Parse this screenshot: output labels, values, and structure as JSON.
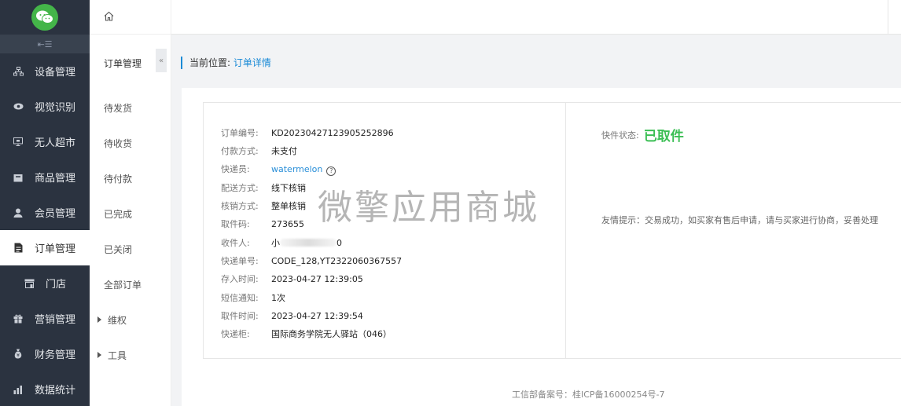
{
  "sidebar": {
    "items": [
      {
        "label": "设备管理",
        "icon": "device-icon"
      },
      {
        "label": "视觉识别",
        "icon": "eye-icon"
      },
      {
        "label": "无人超市",
        "icon": "monitor-icon"
      },
      {
        "label": "商品管理",
        "icon": "box-icon"
      },
      {
        "label": "会员管理",
        "icon": "user-icon"
      },
      {
        "label": "订单管理",
        "icon": "document-icon"
      },
      {
        "label": "门店",
        "icon": "store-icon"
      },
      {
        "label": "营销管理",
        "icon": "gift-icon"
      },
      {
        "label": "财务管理",
        "icon": "money-bag-icon"
      },
      {
        "label": "数据统计",
        "icon": "bar-chart-icon"
      }
    ]
  },
  "submenu": {
    "title": "订单管理",
    "items": [
      "待发货",
      "待收货",
      "待付款",
      "已完成",
      "已关闭",
      "全部订单"
    ],
    "groups": [
      "维权",
      "工具"
    ]
  },
  "breadcrumb": {
    "prefix": "当前位置:",
    "current": "订单详情"
  },
  "order": {
    "fields": [
      {
        "label": "订单编号:",
        "value": "KD20230427123905252896"
      },
      {
        "label": "付款方式:",
        "value": "未支付"
      },
      {
        "label": "快递员:",
        "value": "watermelon"
      },
      {
        "label": "配送方式:",
        "value": "线下核销"
      },
      {
        "label": "核销方式:",
        "value": "整单核销"
      },
      {
        "label": "取件码:",
        "value": "273655"
      },
      {
        "label": "收件人:",
        "value_prefix": "小",
        "value_suffix": "0"
      },
      {
        "label": "快递单号:",
        "value": "CODE_128,YT2322060367557"
      },
      {
        "label": "存入时间:",
        "value": "2023-04-27 12:39:05"
      },
      {
        "label": "短信通知:",
        "value": "1次"
      },
      {
        "label": "取件时间:",
        "value": "2023-04-27 12:39:54"
      },
      {
        "label": "快递柜:",
        "value": "国际商务学院无人驿站（046）"
      }
    ],
    "status_label": "快件状态:",
    "status_value": "已取件",
    "status_color": "#3cbf55",
    "tips": "友情提示：交易成功，如买家有售后申请，请与买家进行协商，妥善处理"
  },
  "watermark": "微擎应用商城",
  "footer": "工信部备案号：桂ICP备16000254号-7",
  "colors": {
    "sidebar_bg": "#2b3340",
    "accent": "#1a8ad6",
    "logo": "#44b549"
  }
}
